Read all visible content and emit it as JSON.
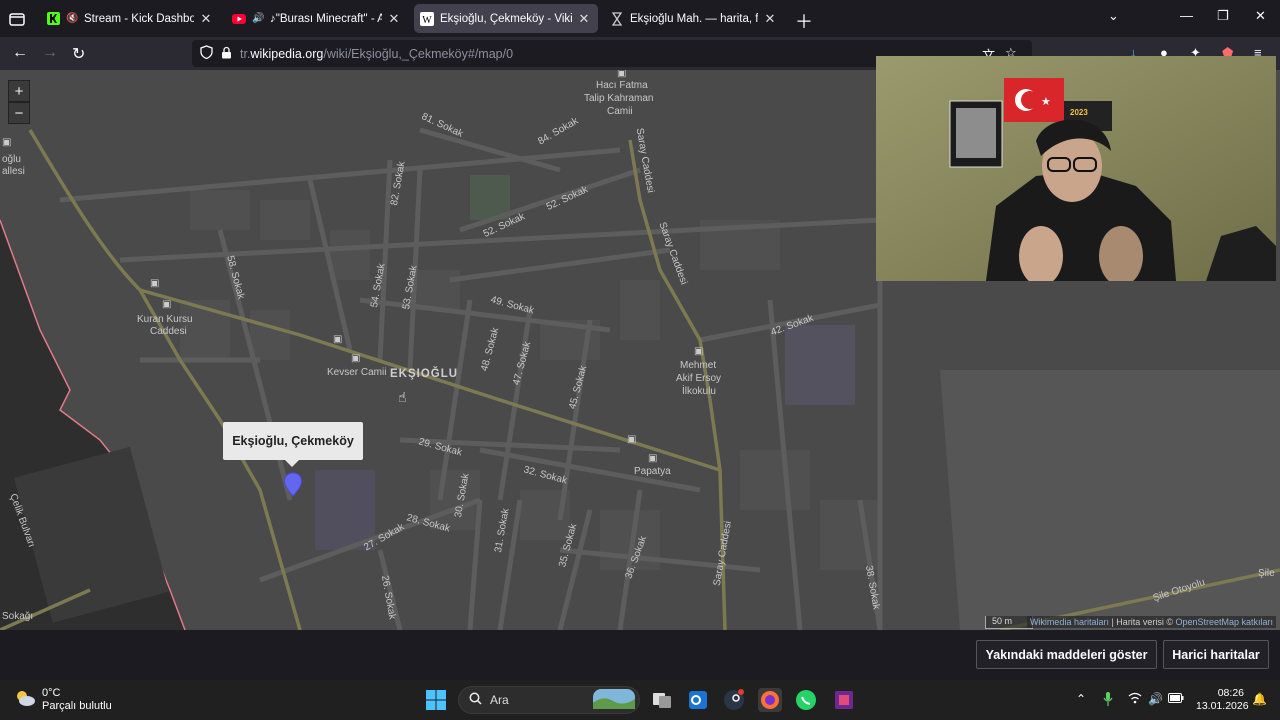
{
  "browser": {
    "tabs": [
      {
        "title": "Stream - Kick Dashboard",
        "favicon": "kick-icon",
        "audio": "muted",
        "active": false
      },
      {
        "title": "♪\"Burası Minecraft\" - A Min",
        "favicon": "youtube-icon",
        "audio": "playing",
        "active": false
      },
      {
        "title": "Ekşioğlu, Çekmeköy - Vikipedi",
        "favicon": "wikipedia-icon",
        "audio": "",
        "active": true
      },
      {
        "title": "Ekşioğlu Mah. — harita, fotoğra",
        "favicon": "map-icon",
        "audio": "",
        "active": false
      }
    ],
    "url": {
      "prefix": "tr.",
      "host": "wikipedia.org",
      "path": "/wiki/Ekşioğlu,_Çekmeköy#/map/0"
    }
  },
  "map": {
    "zoom_in": "+",
    "zoom_out": "−",
    "popup_title": "Ekşioğlu, Çekmeköy",
    "district_label": "EKŞIOĞLU",
    "labels": [
      {
        "text": "Hacı Fatma",
        "k": "poi"
      },
      {
        "text": "Talip Kahraman",
        "k": "poi"
      },
      {
        "text": "Camii",
        "k": "poi"
      },
      {
        "text": "81. Sokak",
        "k": "street"
      },
      {
        "text": "84. Sokak",
        "k": "street"
      },
      {
        "text": "82. Sokak",
        "k": "street"
      },
      {
        "text": "52. Sokak",
        "k": "street"
      },
      {
        "text": "52. Sokak",
        "k": "street"
      },
      {
        "text": "Saray Caddesi",
        "k": "street"
      },
      {
        "text": "Saray Caddesi",
        "k": "street"
      },
      {
        "text": "Saray Caddesi",
        "k": "street"
      },
      {
        "text": "58. Sokak",
        "k": "street"
      },
      {
        "text": "54. Sokak",
        "k": "street"
      },
      {
        "text": "53. Sokak",
        "k": "street"
      },
      {
        "text": "49. Sokak",
        "k": "street"
      },
      {
        "text": "48. Sokak",
        "k": "street"
      },
      {
        "text": "47. Sokak",
        "k": "street"
      },
      {
        "text": "45. Sokak",
        "k": "street"
      },
      {
        "text": "42. Sokak",
        "k": "street"
      },
      {
        "text": "Kuran Kursu",
        "k": "poi"
      },
      {
        "text": "Caddesi",
        "k": "poi"
      },
      {
        "text": "Kevser Camii",
        "k": "poi"
      },
      {
        "text": "Mehmet",
        "k": "poi"
      },
      {
        "text": "Akif Ersoy",
        "k": "poi"
      },
      {
        "text": "İlkokulu",
        "k": "poi"
      },
      {
        "text": "29. Sokak",
        "k": "street"
      },
      {
        "text": "32. Sokak",
        "k": "street"
      },
      {
        "text": "Papatya",
        "k": "poi"
      },
      {
        "text": "30. Sokak",
        "k": "street"
      },
      {
        "text": "28. Sokak",
        "k": "street"
      },
      {
        "text": "27. Sokak",
        "k": "street"
      },
      {
        "text": "31. Sokak",
        "k": "street"
      },
      {
        "text": "35. Sokak",
        "k": "street"
      },
      {
        "text": "36. Sokak",
        "k": "street"
      },
      {
        "text": "26. Sokak",
        "k": "street"
      },
      {
        "text": "38. Sokak",
        "k": "street"
      },
      {
        "text": "Şile Otoyolu",
        "k": "street"
      },
      {
        "text": "Şile",
        "k": "street"
      },
      {
        "text": "Çelik Bulvarı",
        "k": "street"
      },
      {
        "text": "Sokağı",
        "k": "street"
      },
      {
        "text": "oğlu",
        "k": "poi"
      },
      {
        "text": "allesi",
        "k": "poi"
      }
    ],
    "scale": "50 m",
    "attribution_link1": "Wikimedia haritaları",
    "attribution_sep": " | Harita verisi © ",
    "attribution_link2": "OpenStreetMap katkıları"
  },
  "webcam": {
    "banner_text": "2023"
  },
  "map_buttons": {
    "nearby": "Yakındaki maddeleri göster",
    "external": "Harici haritalar"
  },
  "taskbar": {
    "temperature": "0°C",
    "weather_desc": "Parçalı bulutlu",
    "search_placeholder": "Ara",
    "time": "08:26",
    "date": "13.01.2026"
  }
}
